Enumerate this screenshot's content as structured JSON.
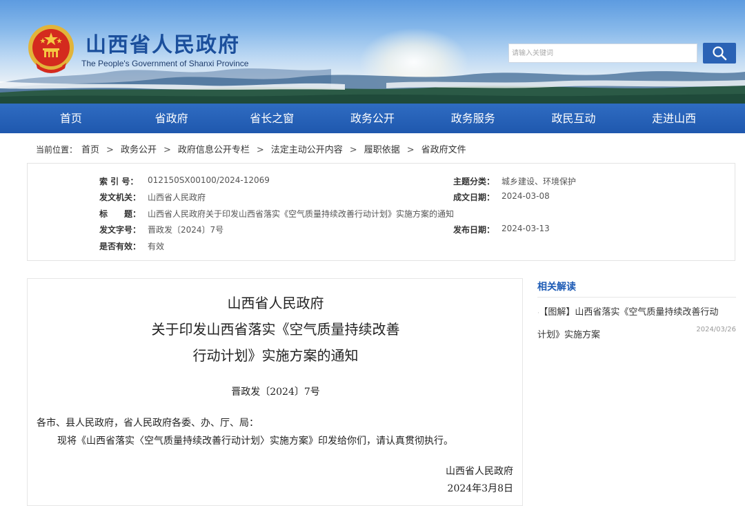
{
  "header": {
    "title": "山西省人民政府",
    "subtitle": "The People's Government of Shanxi Province",
    "search_placeholder": "请输入关键词"
  },
  "nav": [
    "首页",
    "省政府",
    "省长之窗",
    "政务公开",
    "政务服务",
    "政民互动",
    "走进山西"
  ],
  "breadcrumb": {
    "label": "当前位置：",
    "items": [
      "首页",
      "政务公开",
      "政府信息公开专栏",
      "法定主动公开内容",
      "履职依据",
      "省政府文件"
    ]
  },
  "meta": {
    "index_label": "索 引 号：",
    "index_value": "012150SX00100/2024-12069",
    "topic_label": "主题分类：",
    "topic_value": "城乡建设、环境保护",
    "issuer_label": "发文机关：",
    "issuer_value": "山西省人民政府",
    "created_label": "成文日期：",
    "created_value": "2024-03-08",
    "title_label": "标　　题：",
    "title_value": "山西省人民政府关于印发山西省落实《空气质量持续改善行动计划》实施方案的通知",
    "docno_label": "发文字号：",
    "docno_value": "晋政发〔2024〕7号",
    "published_label": "发布日期：",
    "published_value": "2024-03-13",
    "valid_label": "是否有效：",
    "valid_value": "有效"
  },
  "article": {
    "title_lines": [
      "山西省人民政府",
      "关于印发山西省落实《空气质量持续改善",
      "行动计划》实施方案的通知"
    ],
    "doc_no": "晋政发〔2024〕7号",
    "salutation": "各市、县人民政府，省人民政府各委、办、厅、局：",
    "body": "现将《山西省落实〈空气质量持续改善行动计划〉实施方案》印发给你们，请认真贯彻执行。",
    "signature": "山西省人民政府",
    "date": "2024年3月8日"
  },
  "sidebar": {
    "heading": "相关解读",
    "item_line1": "【图解】山西省落实《空气质量持续改善行动",
    "item_line2": "计划》实施方案",
    "item_date": "2024/03/26"
  },
  "colors": {
    "brand_blue": "#1b4f9c",
    "nav_blue": "#2563b8",
    "link_blue": "#1d5bb5"
  },
  "icons": {
    "search": "search-icon",
    "emblem": "national-emblem-icon"
  }
}
